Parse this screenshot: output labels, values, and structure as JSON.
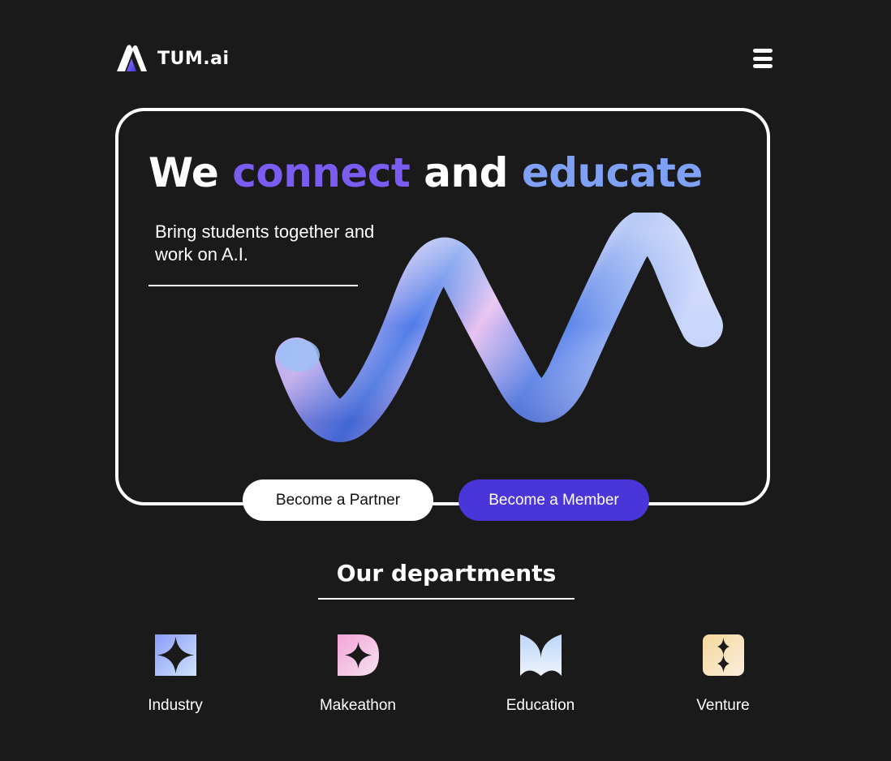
{
  "header": {
    "brand": "TUM.ai",
    "logo_icon": "tum-ai-logo-icon",
    "menu_icon": "hamburger-menu-icon"
  },
  "hero": {
    "headline": {
      "word1": "We",
      "word2": "connect",
      "word3": "and",
      "word4": "educate"
    },
    "tagline": "Bring students together and work on A.I.",
    "image_icon": "holographic-wave-shape",
    "partner_button": "Become a Partner",
    "member_button": "Become a Member"
  },
  "departments": {
    "title": "Our departments",
    "items": [
      {
        "label": "Industry",
        "icon": "sparkle-star-icon"
      },
      {
        "label": "Makeathon",
        "icon": "d-shape-star-icon"
      },
      {
        "label": "Education",
        "icon": "m-shape-icon"
      },
      {
        "label": "Venture",
        "icon": "double-star-icon"
      }
    ]
  },
  "colors": {
    "background": "#1a1a1a",
    "accent_purple": "#7b5cf0",
    "accent_blue": "#7ea0f5",
    "member_button": "#4a36d8"
  }
}
